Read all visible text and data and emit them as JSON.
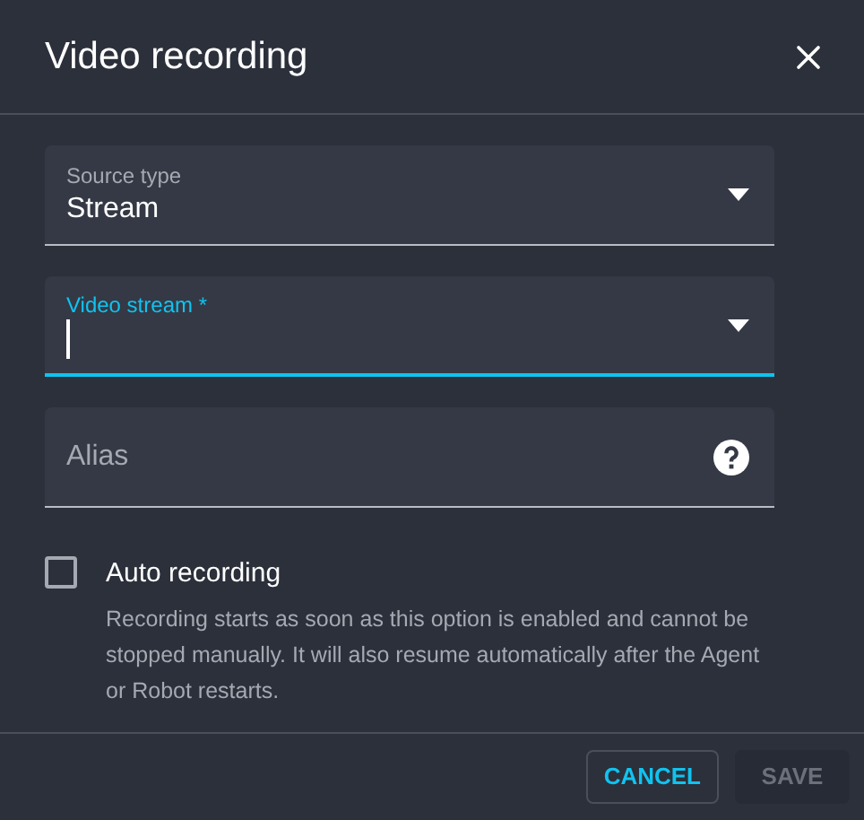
{
  "dialog": {
    "title": "Video recording"
  },
  "fields": [
    {
      "kind": "select",
      "label": "Source type",
      "value": "Stream",
      "focused": false
    },
    {
      "kind": "select",
      "label": "Video stream *",
      "focused": true
    },
    {
      "kind": "text",
      "placeholder": "Alias",
      "focused": false
    }
  ],
  "auto_recording": {
    "label": "Auto recording",
    "checked": false,
    "description": "Recording starts as soon as this option is enabled and cannot be stopped manually. It will also resume automatically after the Agent or Robot restarts."
  },
  "buttons": [
    {
      "label": "CANCEL",
      "disabled": false
    },
    {
      "label": "SAVE",
      "disabled": true
    }
  ]
}
